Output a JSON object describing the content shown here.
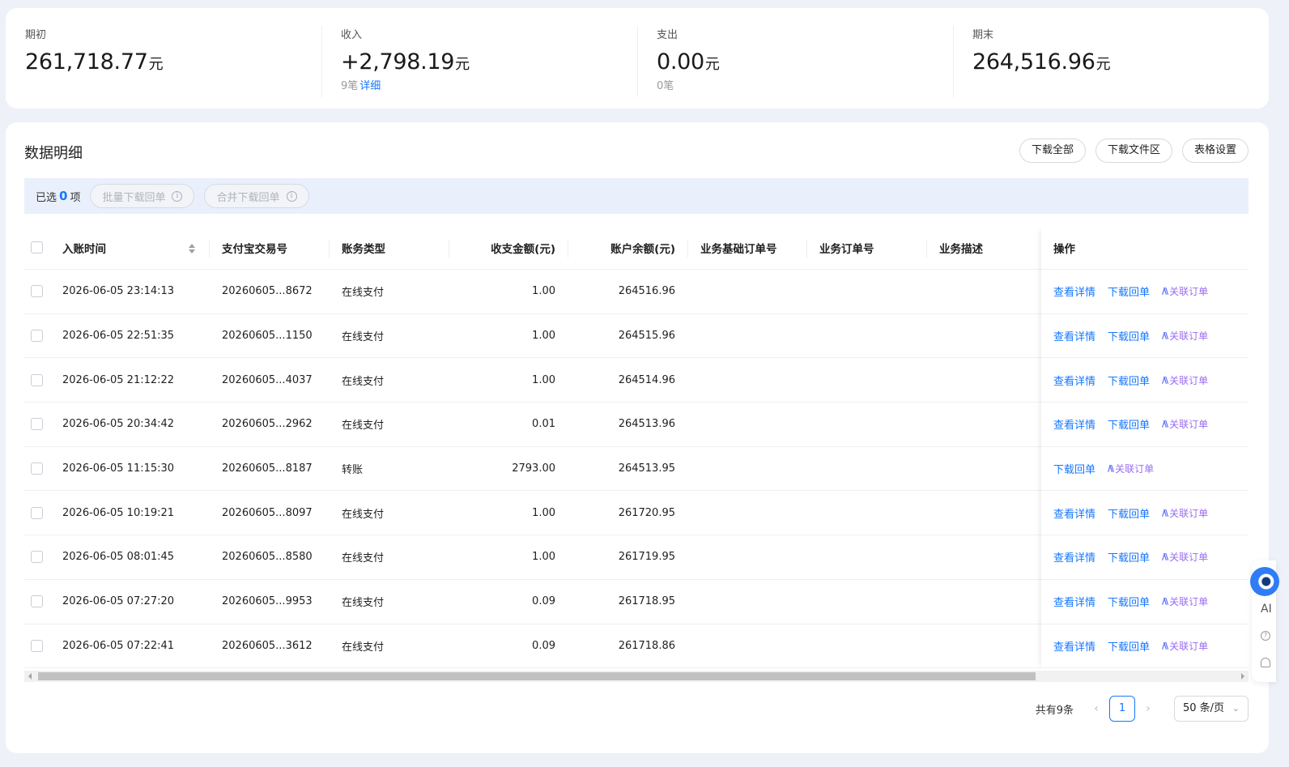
{
  "summary": {
    "opening": {
      "label": "期初",
      "value": "261,718.77",
      "unit": "元"
    },
    "income": {
      "label": "收入",
      "value": "+2,798.19",
      "unit": "元",
      "count": "9笔",
      "detail_link": "详细"
    },
    "expense": {
      "label": "支出",
      "value": "0.00",
      "unit": "元",
      "count": "0笔"
    },
    "closing": {
      "label": "期末",
      "value": "264,516.96",
      "unit": "元"
    }
  },
  "detail": {
    "title": "数据明细",
    "actions": {
      "download_all": "下载全部",
      "download_files": "下载文件区",
      "table_settings": "表格设置"
    }
  },
  "selection": {
    "prefix": "已选",
    "count": "0",
    "suffix": "项",
    "batch_download": "批量下载回单",
    "merge_download": "合并下载回单"
  },
  "table": {
    "columns": {
      "time": "入账时间",
      "trade_no": "支付宝交易号",
      "type": "账务类型",
      "amount": "收支金额(元)",
      "balance": "账户余额(元)",
      "base_order": "业务基础订单号",
      "order": "业务订单号",
      "desc": "业务描述",
      "ops": "操作"
    },
    "rows": [
      {
        "time": "2026-06-05 23:14:13",
        "trade_no": "20260605...8672",
        "type": "在线支付",
        "amount": "1.00",
        "balance": "264516.96",
        "has_view": true
      },
      {
        "time": "2026-06-05 22:51:35",
        "trade_no": "20260605...1150",
        "type": "在线支付",
        "amount": "1.00",
        "balance": "264515.96",
        "has_view": true
      },
      {
        "time": "2026-06-05 21:12:22",
        "trade_no": "20260605...4037",
        "type": "在线支付",
        "amount": "1.00",
        "balance": "264514.96",
        "has_view": true
      },
      {
        "time": "2026-06-05 20:34:42",
        "trade_no": "20260605...2962",
        "type": "在线支付",
        "amount": "0.01",
        "balance": "264513.96",
        "has_view": true
      },
      {
        "time": "2026-06-05 11:15:30",
        "trade_no": "20260605...8187",
        "type": "转账",
        "amount": "2793.00",
        "balance": "264513.95",
        "has_view": false
      },
      {
        "time": "2026-06-05 10:19:21",
        "trade_no": "20260605...8097",
        "type": "在线支付",
        "amount": "1.00",
        "balance": "261720.95",
        "has_view": true
      },
      {
        "time": "2026-06-05 08:01:45",
        "trade_no": "20260605...8580",
        "type": "在线支付",
        "amount": "1.00",
        "balance": "261719.95",
        "has_view": true
      },
      {
        "time": "2026-06-05 07:27:20",
        "trade_no": "20260605...9953",
        "type": "在线支付",
        "amount": "0.09",
        "balance": "261718.95",
        "has_view": true
      },
      {
        "time": "2026-06-05 07:22:41",
        "trade_no": "20260605...3612",
        "type": "在线支付",
        "amount": "0.09",
        "balance": "261718.86",
        "has_view": true
      }
    ],
    "op_labels": {
      "view": "查看详情",
      "download": "下载回单",
      "link_order": "关联订单"
    }
  },
  "pagination": {
    "total": "共有9条",
    "current_page": "1",
    "page_size": "50 条/页"
  },
  "assistant": {
    "label": "AI"
  },
  "colors": {
    "accent": "#1677ff",
    "ai_purple": "#9b6cf0",
    "background": "#eef1f7"
  }
}
